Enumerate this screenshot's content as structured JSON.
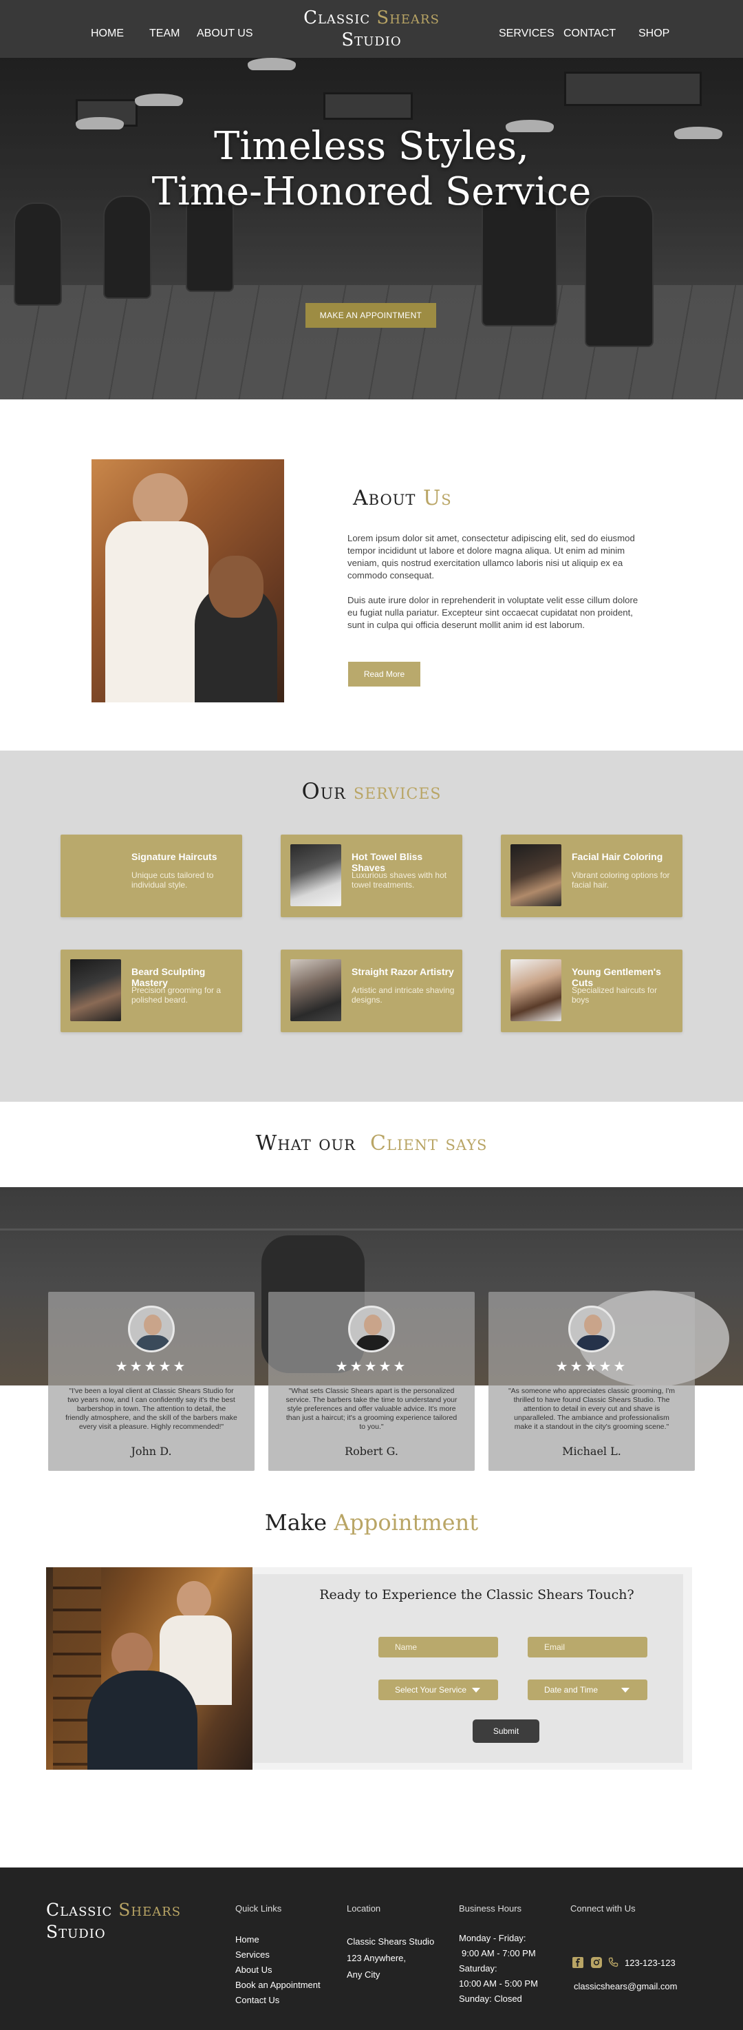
{
  "nav": {
    "left": [
      "HOME",
      "TEAM",
      "ABOUT US"
    ],
    "right": [
      "SERVICES",
      "CONTACT",
      "SHOP"
    ],
    "brand_line1_a": "Classic",
    "brand_line1_b": "Shears",
    "brand_line2": "Studio"
  },
  "hero": {
    "title_line1": "Timeless Styles,",
    "title_line2": "Time-Honored Service",
    "cta": "MAKE AN APPOINTMENT"
  },
  "about": {
    "title_a": "About",
    "title_b": "Us",
    "p1": "Lorem ipsum dolor sit amet, consectetur adipiscing elit, sed do eiusmod tempor incididunt ut labore et dolore magna aliqua. Ut enim ad minim veniam, quis nostrud exercitation ullamco laboris nisi ut aliquip ex ea commodo consequat.",
    "p2": "Duis aute irure dolor in reprehenderit in voluptate velit esse cillum dolore eu fugiat nulla pariatur. Excepteur sint occaecat cupidatat non proident, sunt in culpa qui officia deserunt mollit anim id est laborum.",
    "button": "Read More"
  },
  "services": {
    "title_a": "Our",
    "title_b": "services",
    "items": [
      {
        "title": "Signature Haircuts",
        "desc": "Unique cuts tailored to individual style."
      },
      {
        "title": "Hot Towel Bliss Shaves",
        "desc": "Luxurious shaves with hot towel treatments."
      },
      {
        "title": "Facial Hair Coloring",
        "desc": "Vibrant coloring options for facial hair."
      },
      {
        "title": "Beard Sculpting Mastery",
        "desc": "Precision grooming for a polished beard."
      },
      {
        "title": "Straight Razor Artistry",
        "desc": "Artistic and intricate shaving designs."
      },
      {
        "title": "Young Gentlemen's Cuts",
        "desc": "Specialized haircuts for boys"
      }
    ]
  },
  "clients": {
    "title_a": "What our",
    "title_b": "Client says",
    "stars": "★★★★★",
    "items": [
      {
        "quote": "\"I've been a loyal client at Classic Shears Studio for two years now, and I can confidently say it's the best barbershop in town. The attention to detail, the friendly atmosphere, and the skill of the barbers make every visit a pleasure. Highly recommended!\"",
        "name": "John D."
      },
      {
        "quote": "\"What sets Classic Shears apart is the personalized service. The barbers take the time to understand your style preferences and offer valuable advice. It's more than just a haircut; it's a grooming experience tailored to you.\"",
        "name": "Robert G."
      },
      {
        "quote": "\"As someone who appreciates classic grooming, I'm thrilled to have found Classic Shears Studio. The attention to detail in every cut and shave is unparalleled. The ambiance and professionalism make it a standout in the city's grooming scene.\"",
        "name": "Michael L."
      }
    ]
  },
  "appointment": {
    "title_a": "Make",
    "title_b": "Appointment",
    "heading": "Ready to Experience the Classic Shears Touch?",
    "name_placeholder": "Name",
    "email_placeholder": "Email",
    "service_select": "Select Your Service",
    "datetime_select": "Date and Time",
    "submit": "Submit"
  },
  "footer": {
    "brand_line1_a": "Classic",
    "brand_line1_b": "Shears",
    "brand_line2": "Studio",
    "quick_links_title": "Quick Links",
    "quick_links": [
      "Home",
      "Services",
      "About Us",
      "Book an Appointment",
      "Contact Us"
    ],
    "location_title": "Location",
    "location": [
      "Classic Shears Studio",
      "123 Anywhere,",
      "Any City"
    ],
    "hours_title": "Business Hours",
    "hours": [
      "Monday - Friday:",
      "9:00 AM - 7:00 PM",
      "Saturday:",
      "10:00 AM - 5:00 PM",
      "Sunday: Closed"
    ],
    "connect_title": "Connect with Us",
    "phone": "123-123-123",
    "email": "classicshears@gmail.com"
  },
  "colors": {
    "gold": "#b9a565",
    "gold_button": "#9d8c43",
    "card": "#b9a96c",
    "services_bg": "#d9d9d9",
    "footer_bg": "#232323"
  }
}
